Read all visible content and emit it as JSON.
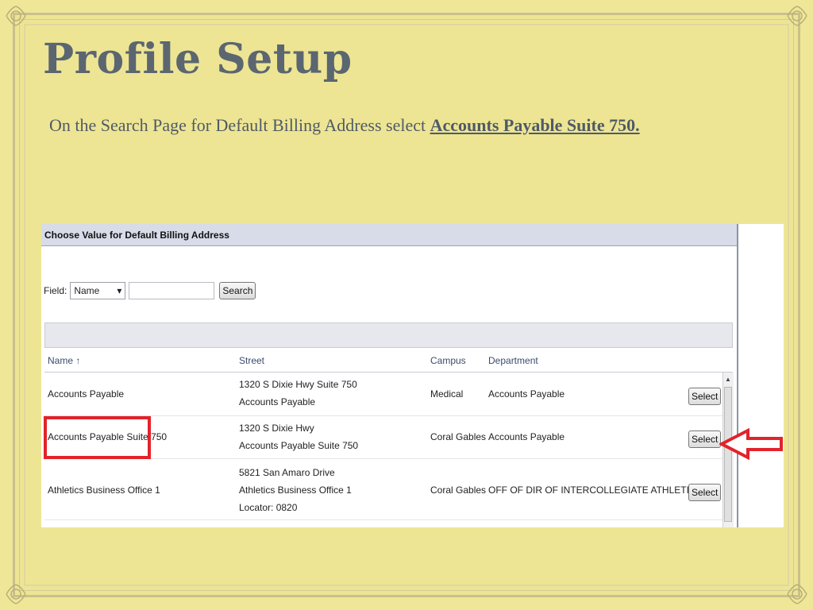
{
  "slide": {
    "title": "Profile Setup",
    "instruction_prefix": "On the Search Page for Default Billing Address select ",
    "instruction_emphasis": "Accounts Payable Suite 750."
  },
  "panel": {
    "header": "Choose Value for Default Billing Address",
    "field_label": "Field:",
    "field_value": "Name",
    "search_input_value": "",
    "search_button": "Search",
    "columns": {
      "name": "Name",
      "sort_indicator": "↑",
      "street": "Street",
      "campus": "Campus",
      "department": "Department"
    },
    "rows": [
      {
        "name": "Accounts Payable",
        "street_lines": [
          "1320 S Dixie Hwy Suite 750",
          "Accounts Payable"
        ],
        "campus": "Medical",
        "department": "Accounts Payable",
        "action": "Select"
      },
      {
        "name": "Accounts Payable Suite 750",
        "street_lines": [
          "1320 S Dixie Hwy",
          "Accounts Payable Suite 750"
        ],
        "campus": "Coral Gables",
        "department": "Accounts Payable",
        "action": "Select"
      },
      {
        "name": "Athletics Business Office 1",
        "street_lines": [
          "5821 San Amaro Drive",
          "Athletics Business Office 1",
          "Locator: 0820"
        ],
        "campus": "Coral Gables",
        "department": "OFF OF DIR OF INTERCOLLEGIATE ATHLETICS",
        "action": "Select"
      }
    ]
  },
  "colors": {
    "background": "#efe698",
    "title": "#5b6670",
    "highlight": "#e2232a",
    "header_band": "#d8dce8"
  },
  "icons": [
    "corner-ornament-icon",
    "dropdown-caret-icon",
    "scroll-up-icon",
    "red-arrow-icon"
  ]
}
